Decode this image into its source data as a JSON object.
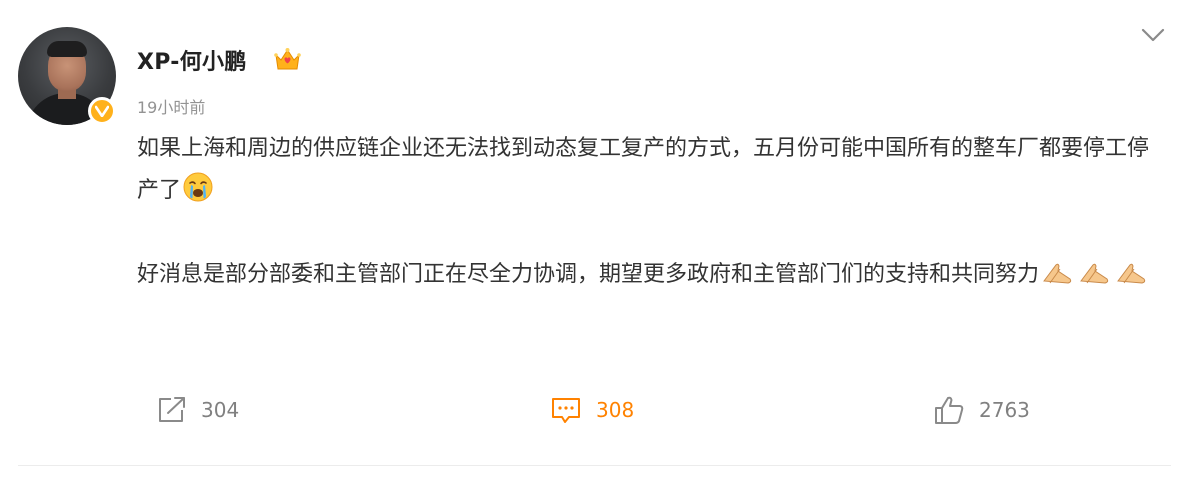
{
  "post": {
    "author": "XP-何小鹏",
    "timestamp": "19小时前",
    "paragraphs": [
      "如果上海和周边的供应链企业还无法找到动态复工复产的方式，五月份可能中国所有的整车厂都要停工停产了",
      "好消息是部分部委和主管部门正在尽全力协调，期望更多政府和主管部门们的支持和共同努力"
    ],
    "emojis": {
      "para1": [
        "crying-face"
      ],
      "para2": [
        "praying-hands",
        "praying-hands",
        "praying-hands"
      ]
    }
  },
  "actions": {
    "repost_count": "304",
    "comment_count": "308",
    "like_count": "2763"
  },
  "colors": {
    "accent": "#ff8200",
    "verified": "#ffb11b",
    "muted": "#939393",
    "text": "#333333"
  }
}
